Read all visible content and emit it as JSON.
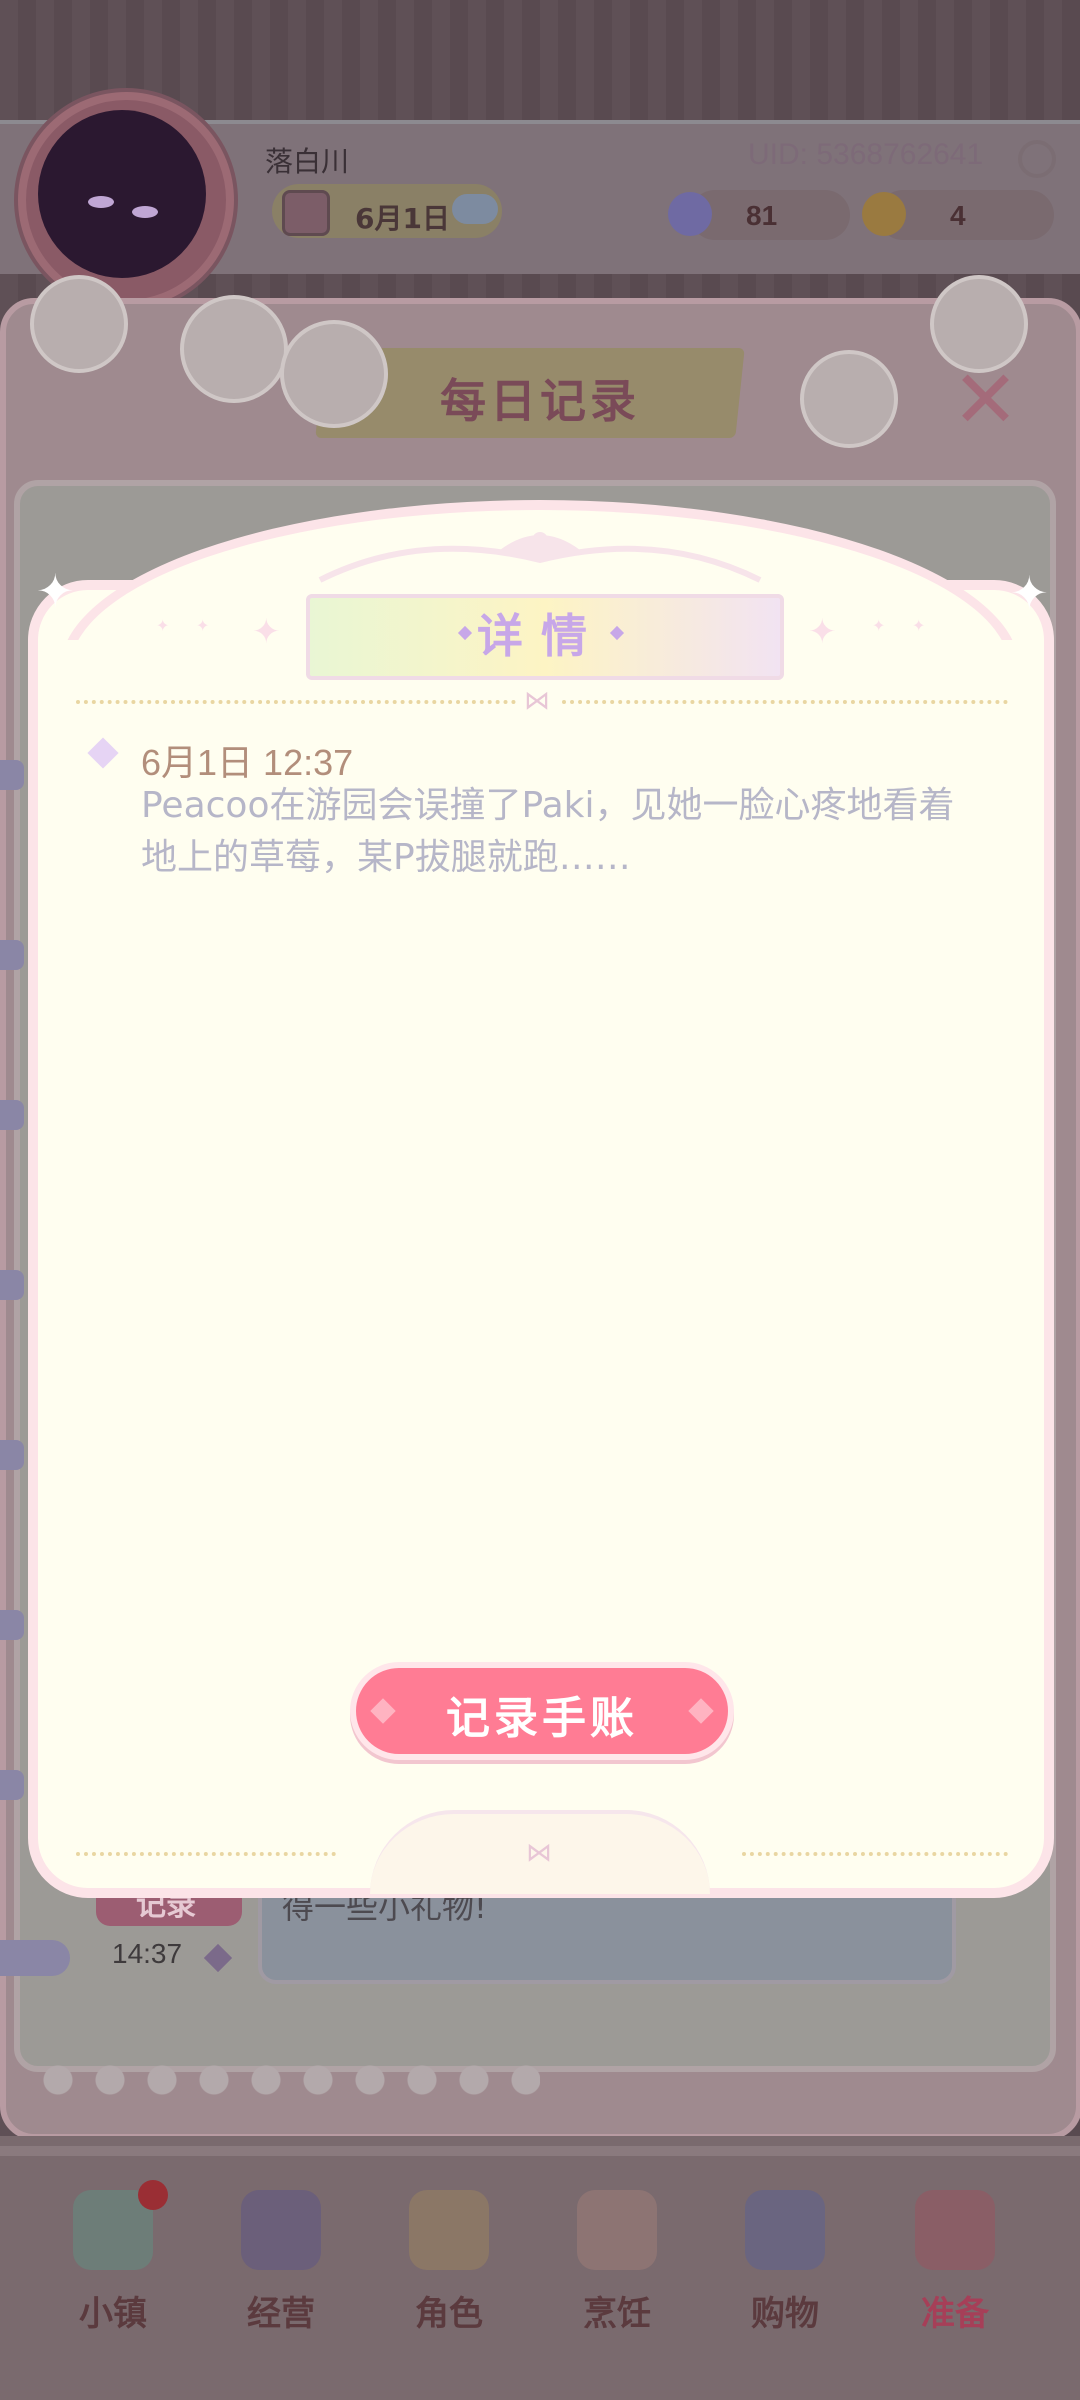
{
  "player": {
    "name": "落白川",
    "uid": "UID: 5368762641",
    "date": "6月1日",
    "currency_a": "81",
    "currency_b": "4"
  },
  "daily_record": {
    "title": "每日记录",
    "close_icon": "close-x-icon",
    "entry_badge": "记录",
    "entry_time": "14:37",
    "entry_preview": "得一些小礼物!"
  },
  "detail": {
    "title": "详情",
    "entry": {
      "date": "6月1日 12:37",
      "text": "Peacoo在游园会误撞了Paki，见她一脸心疼地看着地上的草莓，某P拔腿就跑……"
    },
    "record_button": "记录手账"
  },
  "nav": {
    "items": [
      {
        "label": "小镇",
        "icon": "map-icon"
      },
      {
        "label": "经营",
        "icon": "shop-bag-icon"
      },
      {
        "label": "角色",
        "icon": "character-icon"
      },
      {
        "label": "烹饪",
        "icon": "cake-icon"
      },
      {
        "label": "购物",
        "icon": "shopping-bag-icon"
      },
      {
        "label": "准备",
        "icon": "picnic-basket-icon"
      }
    ],
    "active": "准备"
  },
  "colors": {
    "accent_pink": "#ff7c94",
    "modal_bg": "#fffef0",
    "title_purple": "#c7a7e8"
  }
}
